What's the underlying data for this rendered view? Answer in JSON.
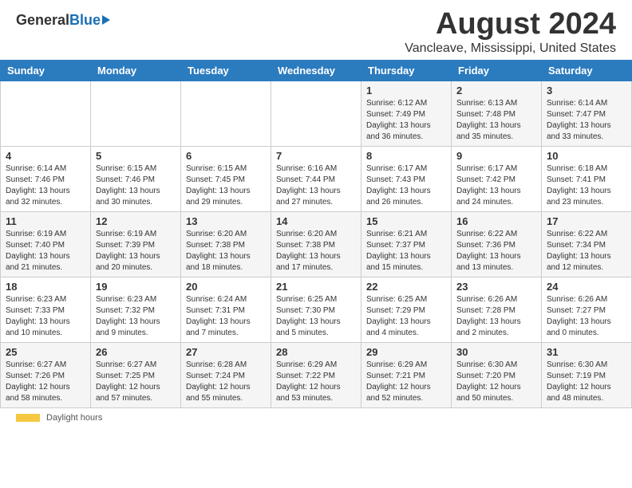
{
  "header": {
    "logo_general": "General",
    "logo_blue": "Blue",
    "main_title": "August 2024",
    "subtitle": "Vancleave, Mississippi, United States"
  },
  "calendar": {
    "days_of_week": [
      "Sunday",
      "Monday",
      "Tuesday",
      "Wednesday",
      "Thursday",
      "Friday",
      "Saturday"
    ],
    "weeks": [
      [
        {
          "day": "",
          "info": ""
        },
        {
          "day": "",
          "info": ""
        },
        {
          "day": "",
          "info": ""
        },
        {
          "day": "",
          "info": ""
        },
        {
          "day": "1",
          "info": "Sunrise: 6:12 AM\nSunset: 7:49 PM\nDaylight: 13 hours and 36 minutes."
        },
        {
          "day": "2",
          "info": "Sunrise: 6:13 AM\nSunset: 7:48 PM\nDaylight: 13 hours and 35 minutes."
        },
        {
          "day": "3",
          "info": "Sunrise: 6:14 AM\nSunset: 7:47 PM\nDaylight: 13 hours and 33 minutes."
        }
      ],
      [
        {
          "day": "4",
          "info": "Sunrise: 6:14 AM\nSunset: 7:46 PM\nDaylight: 13 hours and 32 minutes."
        },
        {
          "day": "5",
          "info": "Sunrise: 6:15 AM\nSunset: 7:46 PM\nDaylight: 13 hours and 30 minutes."
        },
        {
          "day": "6",
          "info": "Sunrise: 6:15 AM\nSunset: 7:45 PM\nDaylight: 13 hours and 29 minutes."
        },
        {
          "day": "7",
          "info": "Sunrise: 6:16 AM\nSunset: 7:44 PM\nDaylight: 13 hours and 27 minutes."
        },
        {
          "day": "8",
          "info": "Sunrise: 6:17 AM\nSunset: 7:43 PM\nDaylight: 13 hours and 26 minutes."
        },
        {
          "day": "9",
          "info": "Sunrise: 6:17 AM\nSunset: 7:42 PM\nDaylight: 13 hours and 24 minutes."
        },
        {
          "day": "10",
          "info": "Sunrise: 6:18 AM\nSunset: 7:41 PM\nDaylight: 13 hours and 23 minutes."
        }
      ],
      [
        {
          "day": "11",
          "info": "Sunrise: 6:19 AM\nSunset: 7:40 PM\nDaylight: 13 hours and 21 minutes."
        },
        {
          "day": "12",
          "info": "Sunrise: 6:19 AM\nSunset: 7:39 PM\nDaylight: 13 hours and 20 minutes."
        },
        {
          "day": "13",
          "info": "Sunrise: 6:20 AM\nSunset: 7:38 PM\nDaylight: 13 hours and 18 minutes."
        },
        {
          "day": "14",
          "info": "Sunrise: 6:20 AM\nSunset: 7:38 PM\nDaylight: 13 hours and 17 minutes."
        },
        {
          "day": "15",
          "info": "Sunrise: 6:21 AM\nSunset: 7:37 PM\nDaylight: 13 hours and 15 minutes."
        },
        {
          "day": "16",
          "info": "Sunrise: 6:22 AM\nSunset: 7:36 PM\nDaylight: 13 hours and 13 minutes."
        },
        {
          "day": "17",
          "info": "Sunrise: 6:22 AM\nSunset: 7:34 PM\nDaylight: 13 hours and 12 minutes."
        }
      ],
      [
        {
          "day": "18",
          "info": "Sunrise: 6:23 AM\nSunset: 7:33 PM\nDaylight: 13 hours and 10 minutes."
        },
        {
          "day": "19",
          "info": "Sunrise: 6:23 AM\nSunset: 7:32 PM\nDaylight: 13 hours and 9 minutes."
        },
        {
          "day": "20",
          "info": "Sunrise: 6:24 AM\nSunset: 7:31 PM\nDaylight: 13 hours and 7 minutes."
        },
        {
          "day": "21",
          "info": "Sunrise: 6:25 AM\nSunset: 7:30 PM\nDaylight: 13 hours and 5 minutes."
        },
        {
          "day": "22",
          "info": "Sunrise: 6:25 AM\nSunset: 7:29 PM\nDaylight: 13 hours and 4 minutes."
        },
        {
          "day": "23",
          "info": "Sunrise: 6:26 AM\nSunset: 7:28 PM\nDaylight: 13 hours and 2 minutes."
        },
        {
          "day": "24",
          "info": "Sunrise: 6:26 AM\nSunset: 7:27 PM\nDaylight: 13 hours and 0 minutes."
        }
      ],
      [
        {
          "day": "25",
          "info": "Sunrise: 6:27 AM\nSunset: 7:26 PM\nDaylight: 12 hours and 58 minutes."
        },
        {
          "day": "26",
          "info": "Sunrise: 6:27 AM\nSunset: 7:25 PM\nDaylight: 12 hours and 57 minutes."
        },
        {
          "day": "27",
          "info": "Sunrise: 6:28 AM\nSunset: 7:24 PM\nDaylight: 12 hours and 55 minutes."
        },
        {
          "day": "28",
          "info": "Sunrise: 6:29 AM\nSunset: 7:22 PM\nDaylight: 12 hours and 53 minutes."
        },
        {
          "day": "29",
          "info": "Sunrise: 6:29 AM\nSunset: 7:21 PM\nDaylight: 12 hours and 52 minutes."
        },
        {
          "day": "30",
          "info": "Sunrise: 6:30 AM\nSunset: 7:20 PM\nDaylight: 12 hours and 50 minutes."
        },
        {
          "day": "31",
          "info": "Sunrise: 6:30 AM\nSunset: 7:19 PM\nDaylight: 12 hours and 48 minutes."
        }
      ]
    ]
  },
  "footer": {
    "daylight_label": "Daylight hours"
  }
}
